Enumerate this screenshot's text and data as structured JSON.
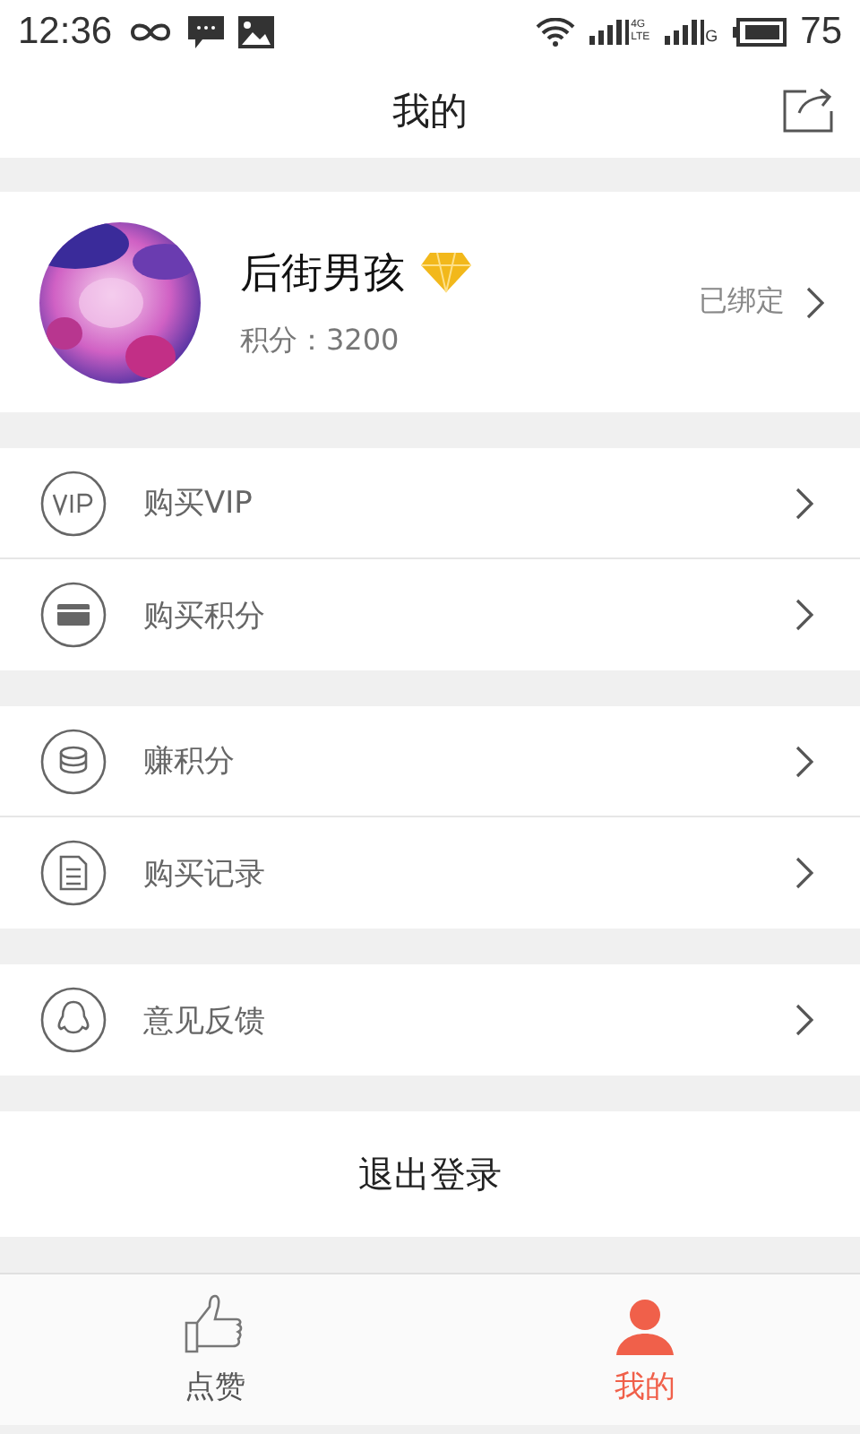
{
  "status_bar": {
    "time": "12:36",
    "sim1_labels": [
      "4G",
      "LTE"
    ],
    "sim2_label": "G",
    "battery": "75"
  },
  "header": {
    "title": "我的"
  },
  "profile": {
    "name": "后街男孩",
    "points": "积分：3200",
    "bind_status": "已绑定"
  },
  "menu_groups": [
    [
      {
        "kind": "vip",
        "label": "购买VIP"
      },
      {
        "kind": "card",
        "label": "购买积分"
      }
    ],
    [
      {
        "kind": "coins",
        "label": "赚积分"
      },
      {
        "kind": "document",
        "label": "购买记录"
      }
    ],
    [
      {
        "kind": "chat",
        "label": "意见反馈"
      }
    ]
  ],
  "logout": "退出登录",
  "tabs": [
    {
      "kind": "thumb",
      "label": "点赞",
      "selected": false
    },
    {
      "kind": "person",
      "label": "我的",
      "selected": true
    }
  ]
}
